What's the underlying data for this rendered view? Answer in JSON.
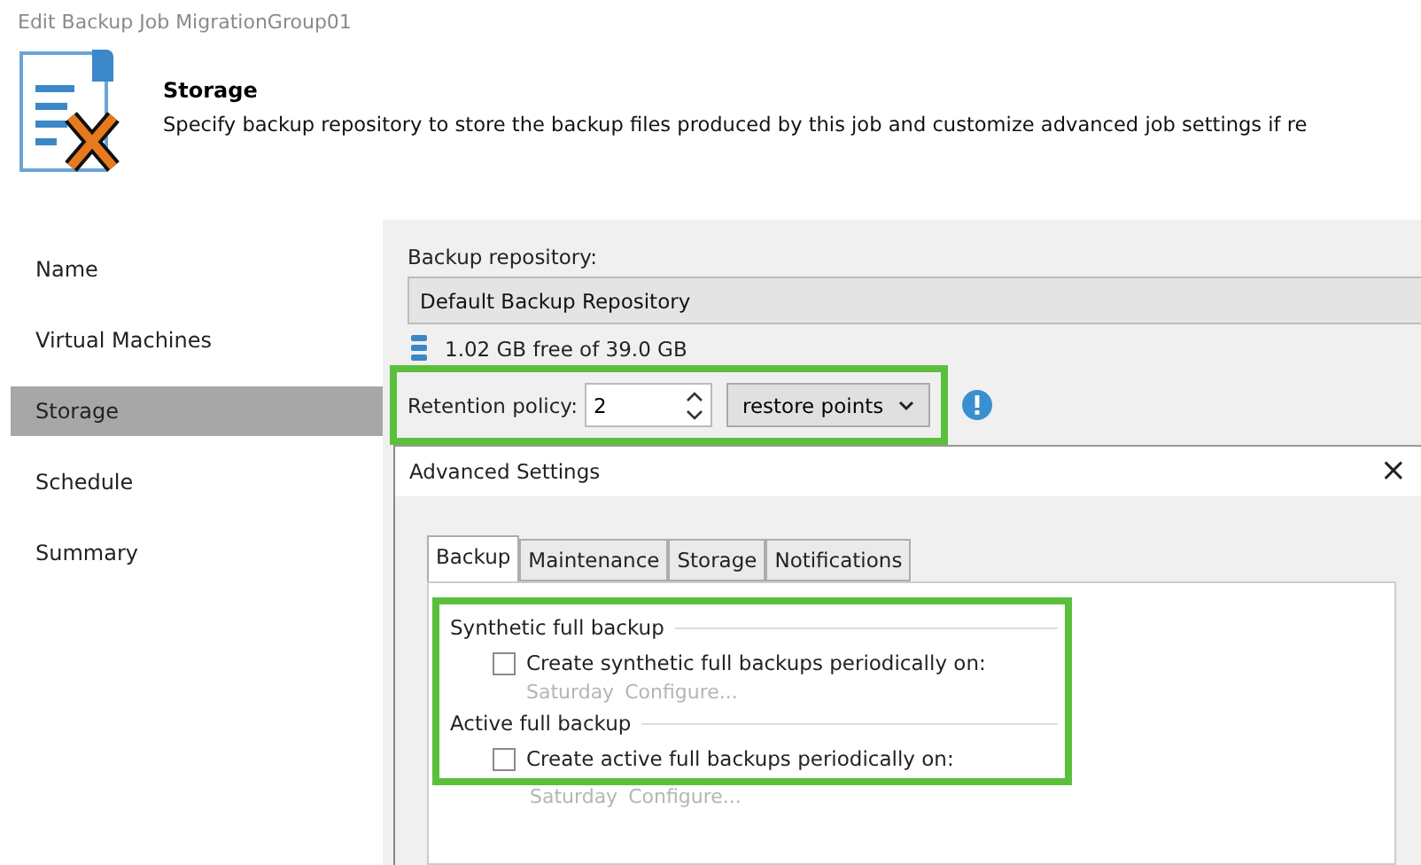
{
  "window": {
    "title": "Edit Backup Job MigrationGroup01"
  },
  "header": {
    "title": "Storage",
    "description": "Specify backup repository to store the backup files produced by this job and customize advanced job settings if re"
  },
  "sidebar": {
    "items": [
      {
        "label": "Name",
        "selected": false
      },
      {
        "label": "Virtual Machines",
        "selected": false
      },
      {
        "label": "Storage",
        "selected": true
      },
      {
        "label": "Schedule",
        "selected": false
      },
      {
        "label": "Summary",
        "selected": false
      }
    ]
  },
  "repository": {
    "label": "Backup repository:",
    "value": "Default Backup Repository",
    "free_space": "1.02 GB free of 39.0 GB"
  },
  "retention": {
    "label": "Retention policy:",
    "value": "2",
    "unit": "restore points"
  },
  "advanced": {
    "title": "Advanced Settings",
    "close": "×",
    "tabs": [
      {
        "label": "Backup",
        "selected": true
      },
      {
        "label": "Maintenance",
        "selected": false
      },
      {
        "label": "Storage",
        "selected": false
      },
      {
        "label": "Notifications",
        "selected": false
      }
    ],
    "groups": [
      {
        "title": "Synthetic full backup",
        "option": "Create synthetic full backups periodically on:",
        "checked": false,
        "day": "Saturday",
        "link": "Configure..."
      },
      {
        "title": "Active full backup",
        "option": "Create active full backups periodically on:",
        "checked": false,
        "day": "Saturday",
        "link": "Configure..."
      }
    ]
  }
}
